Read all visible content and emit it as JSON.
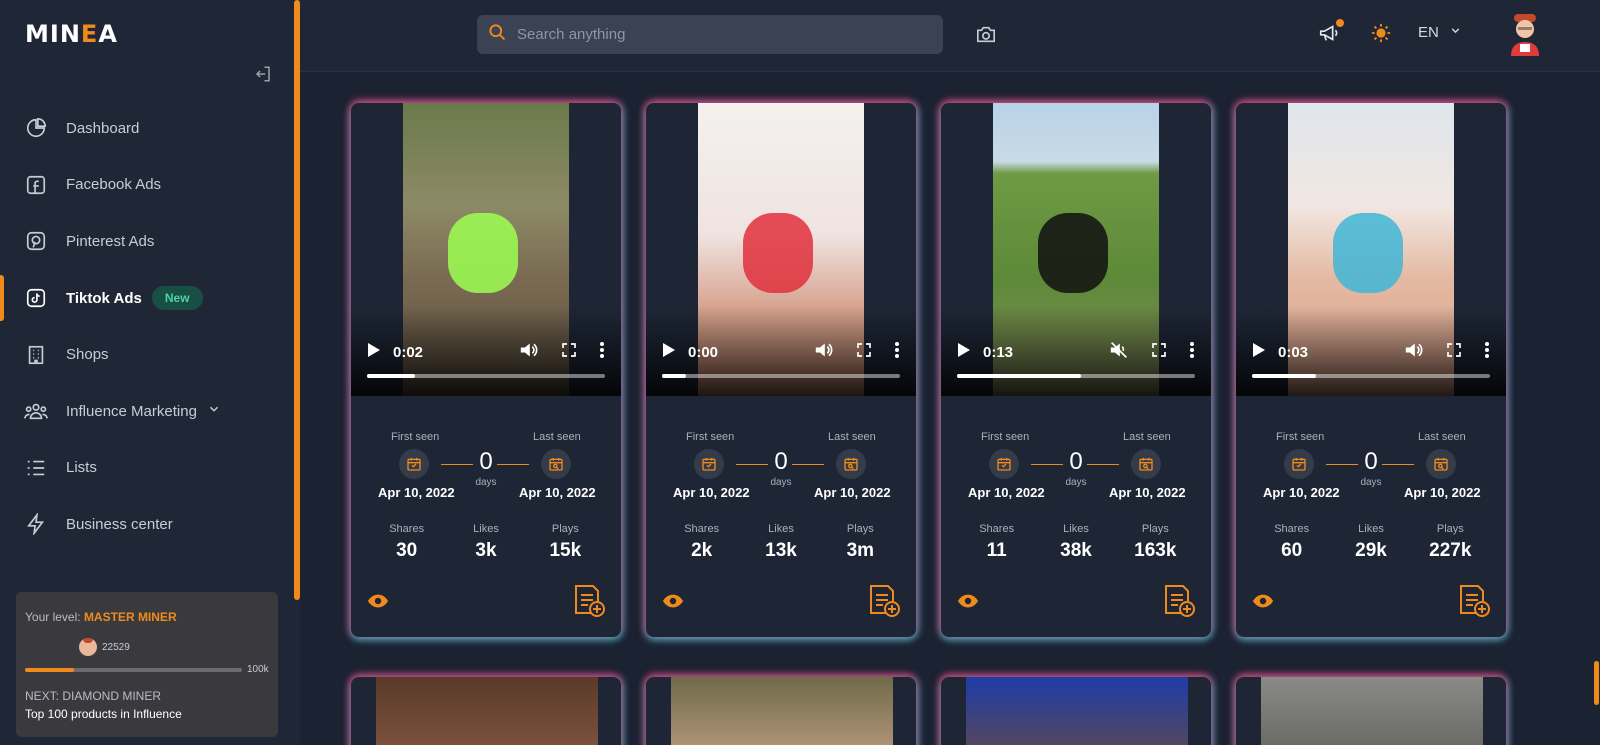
{
  "brand": {
    "logo_left": "MIN",
    "logo_accent": "E",
    "logo_right": "A",
    "accent": "#f08a1d"
  },
  "sidebar": {
    "items": [
      {
        "label": "Dashboard",
        "icon": "pie-chart-icon"
      },
      {
        "label": "Facebook Ads",
        "icon": "facebook-icon"
      },
      {
        "label": "Pinterest Ads",
        "icon": "pinterest-icon"
      },
      {
        "label": "Tiktok Ads",
        "icon": "tiktok-icon",
        "active": true,
        "badge": "New"
      },
      {
        "label": "Shops",
        "icon": "building-icon"
      },
      {
        "label": "Influence Marketing",
        "icon": "people-icon",
        "has_dropdown": true
      },
      {
        "label": "Lists",
        "icon": "list-icon"
      },
      {
        "label": "Business center",
        "icon": "lightning-icon"
      }
    ]
  },
  "level": {
    "prefix": "Your level: ",
    "name": "MASTER MINER",
    "points": "22529",
    "progress": 0.225,
    "max_label": "100k",
    "next_label": "NEXT: DIAMOND MINER",
    "next_desc": "Top 100 products in Influence"
  },
  "topbar": {
    "search_placeholder": "Search anything",
    "language": "EN"
  },
  "cards": [
    {
      "time": "0:02",
      "progress": 0.2,
      "muted": false,
      "first_seen_label": "First seen",
      "last_seen_label": "Last seen",
      "first_seen": "Apr 10, 2022",
      "last_seen": "Apr 10, 2022",
      "days": "0",
      "days_label": "days",
      "shares_label": "Shares",
      "likes_label": "Likes",
      "plays_label": "Plays",
      "shares": "30",
      "likes": "3k",
      "plays": "15k"
    },
    {
      "time": "0:00",
      "progress": 0.1,
      "muted": false,
      "first_seen_label": "First seen",
      "last_seen_label": "Last seen",
      "first_seen": "Apr 10, 2022",
      "last_seen": "Apr 10, 2022",
      "days": "0",
      "days_label": "days",
      "shares_label": "Shares",
      "likes_label": "Likes",
      "plays_label": "Plays",
      "shares": "2k",
      "likes": "13k",
      "plays": "3m"
    },
    {
      "time": "0:13",
      "progress": 0.52,
      "muted": true,
      "first_seen_label": "First seen",
      "last_seen_label": "Last seen",
      "first_seen": "Apr 10, 2022",
      "last_seen": "Apr 10, 2022",
      "days": "0",
      "days_label": "days",
      "shares_label": "Shares",
      "likes_label": "Likes",
      "plays_label": "Plays",
      "shares": "11",
      "likes": "38k",
      "plays": "163k"
    },
    {
      "time": "0:03",
      "progress": 0.27,
      "muted": false,
      "first_seen_label": "First seen",
      "last_seen_label": "Last seen",
      "first_seen": "Apr 10, 2022",
      "last_seen": "Apr 10, 2022",
      "days": "0",
      "days_label": "days",
      "shares_label": "Shares",
      "likes_label": "Likes",
      "plays_label": "Plays",
      "shares": "60",
      "likes": "29k",
      "plays": "227k"
    }
  ]
}
